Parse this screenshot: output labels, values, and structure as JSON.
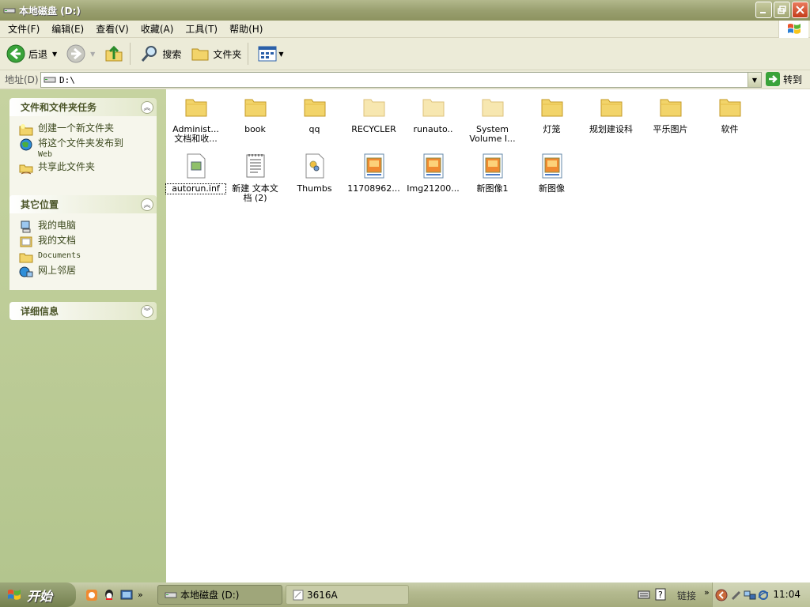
{
  "window": {
    "title": "本地磁盘 (D:)"
  },
  "menu": [
    "文件(F)",
    "编辑(E)",
    "查看(V)",
    "收藏(A)",
    "工具(T)",
    "帮助(H)"
  ],
  "toolbar": {
    "back": "后退",
    "search": "搜索",
    "folders": "文件夹"
  },
  "address": {
    "label": "地址(D)",
    "value": "D:\\",
    "go": "转到"
  },
  "tasks": {
    "title": "文件和文件夹任务",
    "items": [
      "创建一个新文件夹",
      "将这个文件夹发布到",
      "Web",
      "共享此文件夹"
    ]
  },
  "places": {
    "title": "其它位置",
    "items": [
      "我的电脑",
      "我的文档",
      "Documents",
      "网上邻居"
    ]
  },
  "details": {
    "title": "详细信息"
  },
  "files": [
    {
      "line1": "Administ...",
      "line2": "文档和收...",
      "type": "folder"
    },
    {
      "line1": "book",
      "line2": "",
      "type": "folder"
    },
    {
      "line1": "qq",
      "line2": "",
      "type": "folder"
    },
    {
      "line1": "RECYCLER",
      "line2": "",
      "type": "folder-hidden"
    },
    {
      "line1": "runauto..",
      "line2": "",
      "type": "folder-hidden"
    },
    {
      "line1": "System",
      "line2": "Volume I...",
      "type": "folder-hidden"
    },
    {
      "line1": "灯笼",
      "line2": "",
      "type": "folder"
    },
    {
      "line1": "规划建设科",
      "line2": "",
      "type": "folder"
    },
    {
      "line1": "平乐图片",
      "line2": "",
      "type": "folder"
    },
    {
      "line1": "软件",
      "line2": "",
      "type": "folder"
    },
    {
      "line1": "autorun.inf",
      "line2": "",
      "type": "inf"
    },
    {
      "line1": "新建 文本文",
      "line2": "档 (2)",
      "type": "txt"
    },
    {
      "line1": "Thumbs",
      "line2": "",
      "type": "db"
    },
    {
      "line1": "11708962...",
      "line2": "",
      "type": "image"
    },
    {
      "line1": "Img21200...",
      "line2": "",
      "type": "image"
    },
    {
      "line1": "新图像1",
      "line2": "",
      "type": "image"
    },
    {
      "line1": "新图像",
      "line2": "",
      "type": "image"
    }
  ],
  "taskbar": {
    "start": "开始",
    "tasks": [
      "本地磁盘 (D:)",
      "3616A"
    ],
    "links": "链接",
    "clock": "11:04"
  },
  "colors": {
    "pane": "#b3c58e",
    "titlebar": "#9aa070",
    "folder": "#f2d46a"
  }
}
